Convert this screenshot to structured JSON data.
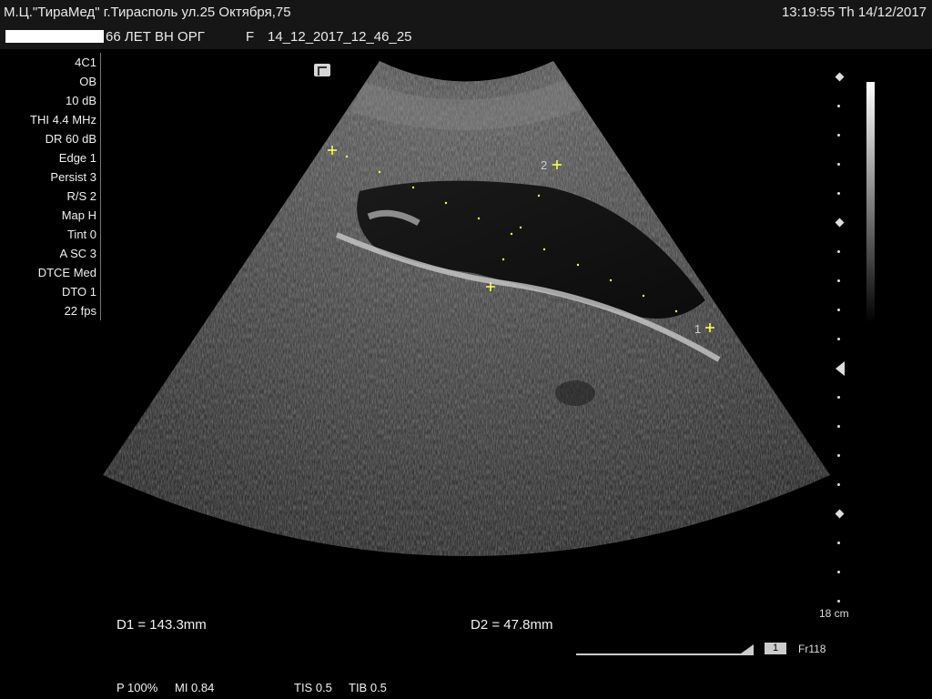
{
  "header": {
    "site": "М.Ц.\"ТираМед\" г.Тирасполь ул.25 Октября,75",
    "clock": "13:19:55  Th  14/12/2017",
    "patient": "66 ЛЕТ ВН ОРГ",
    "gender": "F",
    "study_id": "14_12_2017_12_46_25"
  },
  "params": [
    "4C1",
    "OB",
    "10 dB",
    "THI 4.4 MHz",
    "DR 60 dB",
    "Edge 1",
    "Persist 3",
    "R/S 2",
    "Map H",
    "Tint 0",
    "A SC 3",
    "DTCE Med",
    "DTO 1",
    "22 fps"
  ],
  "calipers": {
    "marker_1": "1",
    "marker_2": "2"
  },
  "measurements": {
    "d1": "D1 = 143.3mm",
    "d2": "D2 = 47.8mm"
  },
  "output": {
    "power": "P 100%",
    "mi": "MI 0.84",
    "tis": "TIS 0.5",
    "tib": "TIB 0.5"
  },
  "depth": "18 cm",
  "cine": {
    "frame_index": "1",
    "frame_label": "Fr118"
  },
  "colors": {
    "caliper": "#ffff44",
    "header_bg": "#161616"
  }
}
